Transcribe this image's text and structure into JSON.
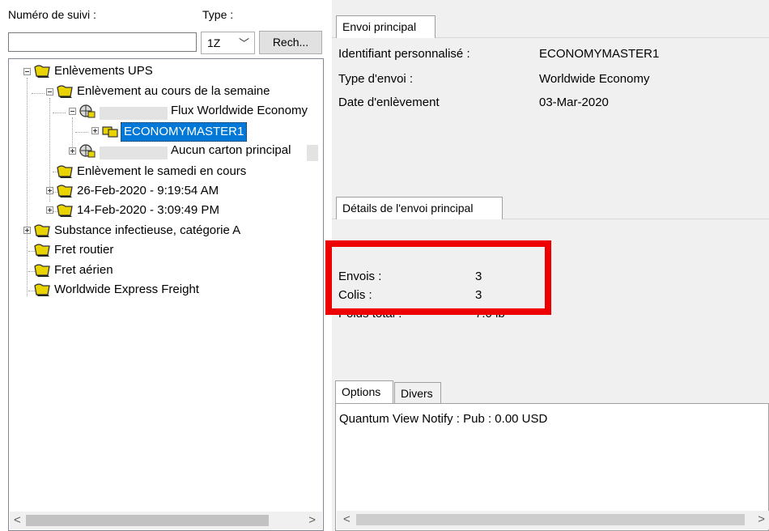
{
  "left": {
    "tracking_label": "Numéro de suivi :",
    "type_label": "Type :",
    "tracking_value": "",
    "type_value": "1Z",
    "search_button": "Rech..."
  },
  "tree": {
    "nodes": [
      {
        "label": "Enlèvements UPS"
      },
      {
        "label": "Enlèvement au cours de la semaine"
      },
      {
        "label": "Flux Worldwide Economy"
      },
      {
        "label": "ECONOMYMASTER1"
      },
      {
        "label": "Aucun carton principal"
      },
      {
        "label": "Enlèvement le samedi en cours"
      },
      {
        "label": "26-Feb-2020 - 9:19:54 AM"
      },
      {
        "label": "14-Feb-2020 - 3:09:49 PM"
      },
      {
        "label": "Substance infectieuse, catégorie A"
      },
      {
        "label": "Fret routier"
      },
      {
        "label": "Fret aérien"
      },
      {
        "label": "Worldwide Express Freight"
      }
    ]
  },
  "main_shipment": {
    "tab": "Envoi principal",
    "rows": [
      {
        "label": "Identifiant personnalisé :",
        "value": "ECONOMYMASTER1"
      },
      {
        "label": "Type d'envoi :",
        "value": "Worldwide Economy"
      },
      {
        "label": "Date d'enlèvement",
        "value": "03-Mar-2020"
      }
    ]
  },
  "details": {
    "tab": "Détails de l'envoi principal",
    "rows": [
      {
        "label": "Envois :",
        "value": "3"
      },
      {
        "label": "Colis :",
        "value": "3"
      },
      {
        "label": "Poids total :",
        "value": "7.0 lb"
      }
    ]
  },
  "options": {
    "tabs": [
      "Options",
      "Divers"
    ],
    "content": "Quantum View Notify :  Pub : 0.00 USD"
  },
  "colors": {
    "highlight": "#ee0000",
    "selection": "#0078d7"
  }
}
